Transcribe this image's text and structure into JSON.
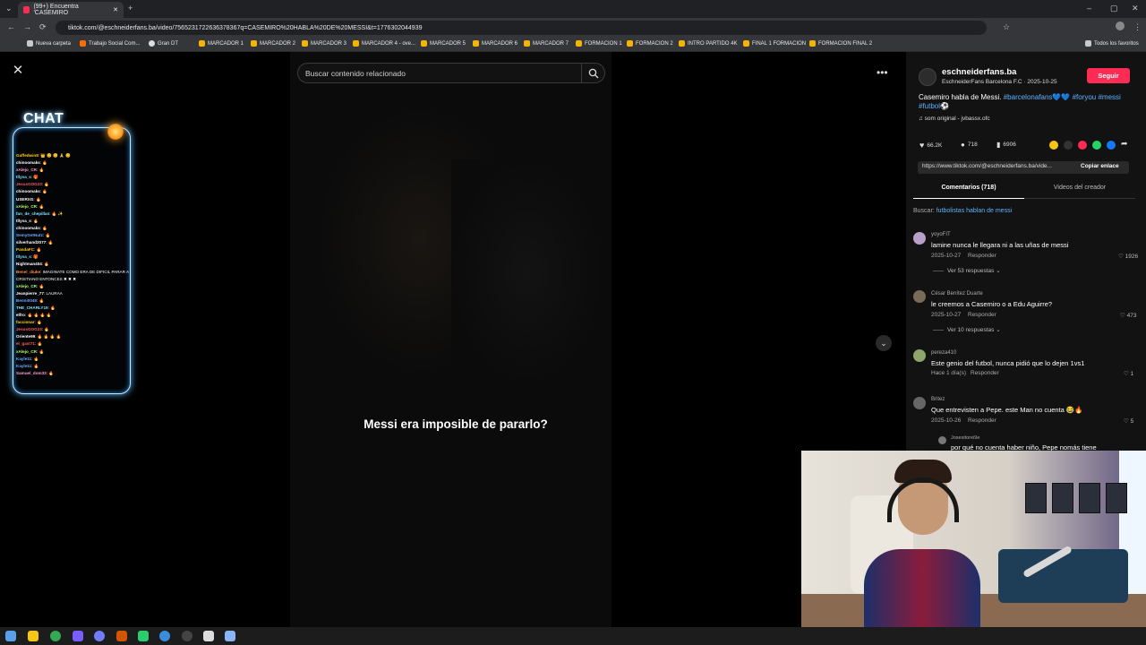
{
  "browser": {
    "tab_title": "(99+) Encuentra 'CASEMIRO",
    "url": "tiktok.com/@eschneiderfans.ba/video/7565231722636378367q=CASEMIRO%20HABLA%20DE%20MESSI&t=1776302044939",
    "bookmarks": [
      "Nueva carpeta",
      "Trabajo Social Com...",
      "Gran DT",
      "MARCADOR 1",
      "MARCADOR 2",
      "MARCADOR 3",
      "MARCADOR 4 - ove...",
      "MARCADOR 5",
      "MARCADOR 6",
      "MARCADOR 7",
      "FORMACION 1",
      "FORMACION 2",
      "INTRO PARTIDO 4K",
      "FINAL 1 FORMACION",
      "FORMACION FINAL 2"
    ],
    "all_bookmarks": "Todos los favoritos"
  },
  "search": {
    "placeholder": "Buscar contenido relacionado"
  },
  "video": {
    "caption": "Messi era imposible de pararlo?"
  },
  "chat_overlay": {
    "title": "CHAT",
    "lines": [
      {
        "user": "Gaffedwin8",
        "msg": "👑 😊 😊 🙏 😊"
      },
      {
        "user": "chinoomaks",
        "msg": "🔥"
      },
      {
        "user": "xAlejo_CR",
        "msg": "🔥"
      },
      {
        "user": "tllyva_s",
        "msg": "🎁"
      },
      {
        "user": "JesusGOG23",
        "msg": "🔥"
      },
      {
        "user": "chinoomaks",
        "msg": "🔥"
      },
      {
        "user": "USERXG",
        "msg": "🔥"
      },
      {
        "user": "xAlejo_CR",
        "msg": "🔥"
      },
      {
        "user": "fan_de_chepillan",
        "msg": "🔥 ✨"
      },
      {
        "user": "tllyva_s",
        "msg": "🔥"
      },
      {
        "user": "chinoomaks",
        "msg": "🔥"
      },
      {
        "user": "SemyGetNutz",
        "msg": "🔥"
      },
      {
        "user": "silverhand2077",
        "msg": "🔥"
      },
      {
        "user": "PandaFC",
        "msg": "🔥"
      },
      {
        "user": "tllyva_s",
        "msg": "🎁"
      },
      {
        "user": "Nightman404",
        "msg": "🔥"
      },
      {
        "user": "Benel_diuke",
        "msg": "IMAGINATE COMO ERA DE DIFICIL PARAR A"
      },
      {
        "user": "",
        "msg": "CRISTIANO ENTONCES ✖ ✖ ✖"
      },
      {
        "user": "xAlejo_CR",
        "msg": "🔥"
      },
      {
        "user": "Jeanpierre_77",
        "msg": "LAURAA"
      },
      {
        "user": "Benni0049",
        "msg": "🔥"
      },
      {
        "user": "THE_CHARLY19",
        "msg": "🔥"
      },
      {
        "user": "elfro",
        "msg": "🔥 🔥 🔥 🔥"
      },
      {
        "user": "faccionar",
        "msg": "🔥"
      },
      {
        "user": "JesusGOG23",
        "msg": "🔥"
      },
      {
        "user": "Oriente99",
        "msg": "🔥 🔥 🔥 🔥"
      },
      {
        "user": "el_gast71",
        "msg": "🔥"
      },
      {
        "user": "xAlejo_CR",
        "msg": "🔥"
      },
      {
        "user": "Kayle11",
        "msg": "🔥"
      },
      {
        "user": "Kayle11",
        "msg": "🔥"
      },
      {
        "user": "Samuel_dom33",
        "msg": "🔥"
      }
    ]
  },
  "post": {
    "username": "eschneiderfans.ba",
    "subtitle": "EschneiderFans Barcelona F.C · 2025-10-25",
    "follow_label": "Seguir",
    "description": "Casemiro habla de Messi.",
    "hashtags_line1": "#barcelonafans💙💙 #foryou #messi",
    "hashtags_line2": "#futbol⚽",
    "sound": "♫ som original - jvbassx.ofc",
    "likes": "66.2K",
    "comments_count": "718",
    "saves": "6906",
    "share_url": "https://www.tiktok.com/@eschneiderfans.ba/vide...",
    "copy_link": "Copiar enlace",
    "tab_comments": "Comentarios (718)",
    "tab_creator": "Videos del creador",
    "search_prefix": "Buscar:",
    "search_suggestion": "futbolistas hablan de messi"
  },
  "comments": [
    {
      "user": "yoyoFIT",
      "text": "lamine nunca le llegara ni a las uñas de messi",
      "date": "2025-10-27",
      "reply": "Responder",
      "likes": "1926",
      "replies": "Ver 53 respuestas"
    },
    {
      "user": "César Benítez Duarte",
      "text": "le creemos a Casemiro o a Edu Aguirre?",
      "date": "2025-10-27",
      "reply": "Responder",
      "likes": "473",
      "replies": "Ver 10 respuestas"
    },
    {
      "user": "pereza410",
      "text": "Este genio del futbol, nunca pidió que lo dejen 1vs1",
      "date": "Hace 1 día(s)",
      "reply": "Responder",
      "likes": "1",
      "replies": ""
    },
    {
      "user": "Britez",
      "text": "Que entrevisten a Pepe. este Man no cuenta 😂🔥",
      "date": "2025-10-26",
      "reply": "Responder",
      "likes": "5",
      "replies": ""
    }
  ],
  "nested_reply": {
    "user": "Josesitorei9e",
    "text": "por qué no cuenta haber niño, Pepe nomás tiene"
  }
}
